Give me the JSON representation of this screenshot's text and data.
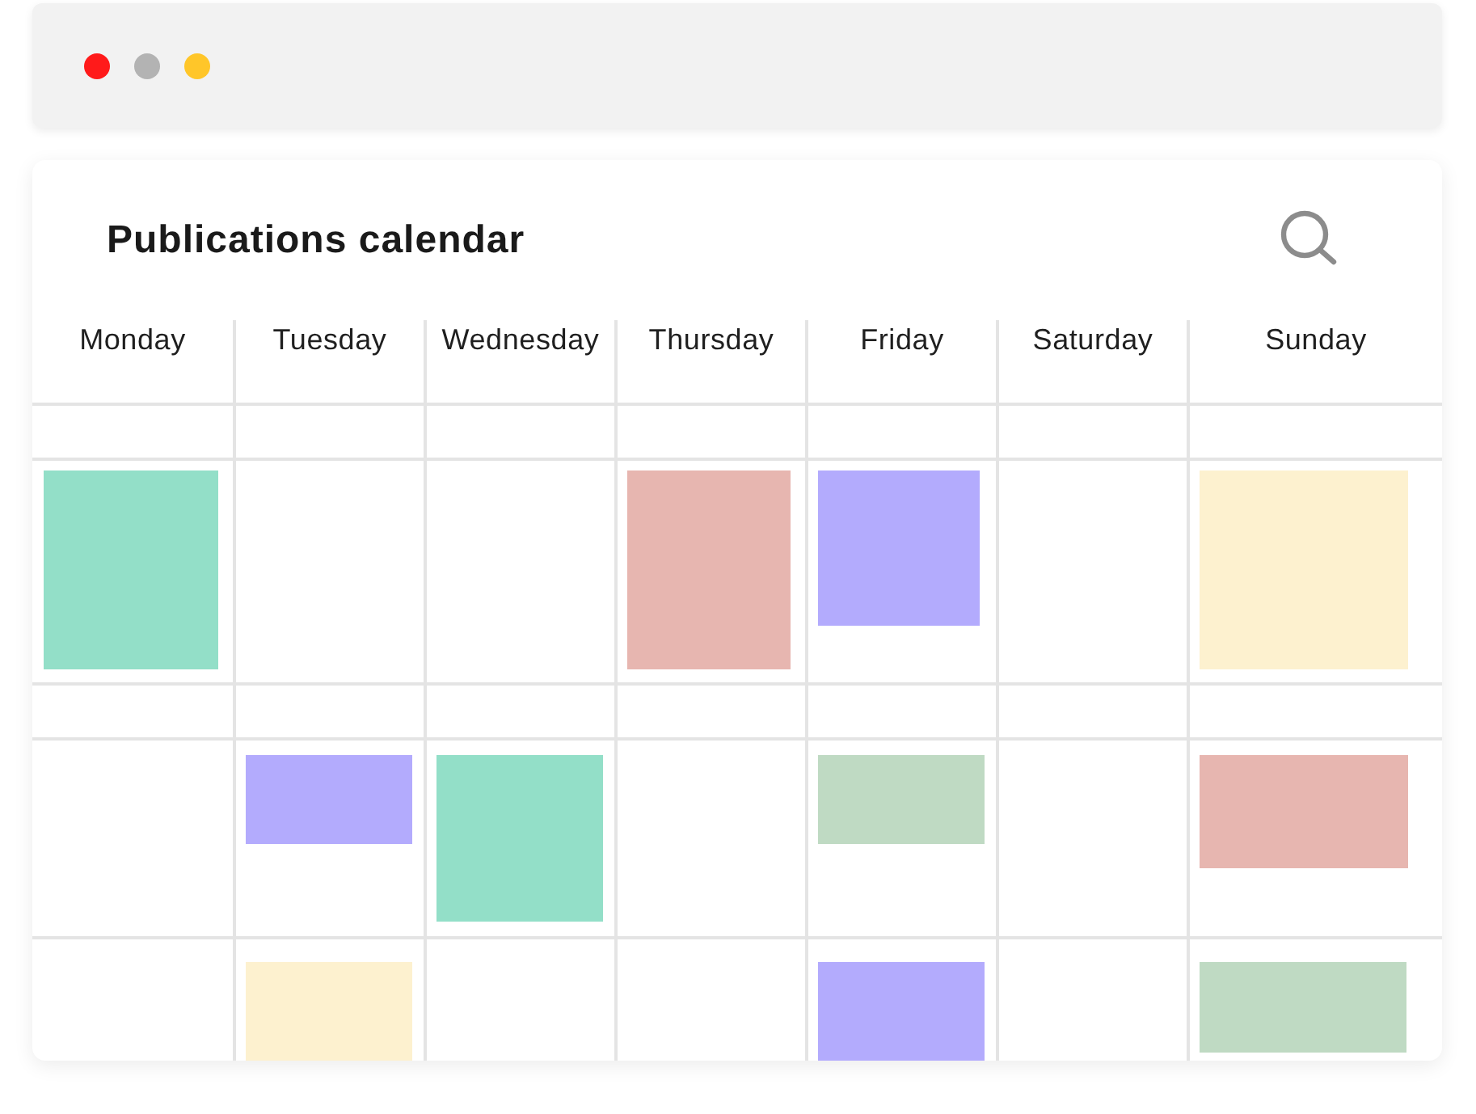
{
  "window": {
    "controls": [
      {
        "color": "#ff1a1a"
      },
      {
        "color": "#b3b3b3"
      },
      {
        "color": "#ffc629"
      }
    ]
  },
  "calendar": {
    "title": "Publications calendar",
    "days": [
      "Monday",
      "Tuesday",
      "Wednesday",
      "Thursday",
      "Friday",
      "Saturday",
      "Sunday"
    ],
    "rows": [
      {
        "cells": [
          {
            "event": {
              "color": "#93dfc8"
            }
          },
          {},
          {},
          {
            "event": {
              "color": "#e7b6b0"
            }
          },
          {
            "event": {
              "color": "#b3abfd"
            }
          },
          {},
          {
            "event": {
              "color": "#fdf1cf"
            }
          }
        ]
      },
      {
        "cells": [
          {},
          {
            "event": {
              "color": "#b3abfd"
            }
          },
          {
            "event": {
              "color": "#93dfc8"
            }
          },
          {},
          {
            "event": {
              "color": "#bfdac3"
            }
          },
          {},
          {
            "event": {
              "color": "#e7b6b0"
            }
          }
        ]
      },
      {
        "cells": [
          {},
          {
            "event": {
              "color": "#fdf1cf"
            }
          },
          {},
          {},
          {
            "event": {
              "color": "#b3abfd"
            }
          },
          {},
          {
            "event": {
              "color": "#bfdac3"
            }
          }
        ]
      }
    ]
  }
}
